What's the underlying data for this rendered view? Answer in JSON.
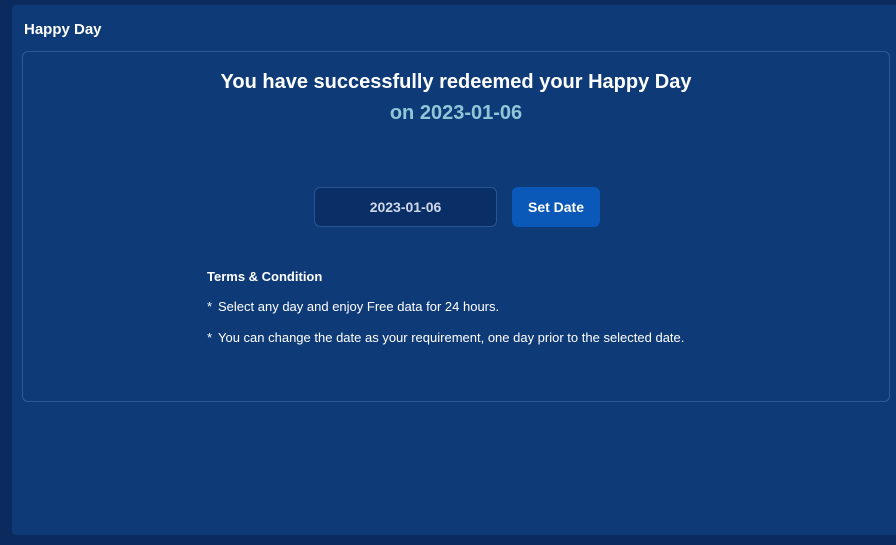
{
  "panel": {
    "title": "Happy Day"
  },
  "message": {
    "headline": "You have successfully redeemed your Happy Day",
    "subline": "on 2023-01-06"
  },
  "date_form": {
    "value": "2023-01-06",
    "button_label": "Set Date"
  },
  "terms": {
    "title": "Terms & Condition",
    "bullet": "*",
    "items": [
      "Select any day and enjoy Free data for 24 hours.",
      "You can change the date as your requirement, one day prior to the selected date."
    ]
  },
  "colors": {
    "page_bg": "#0b2a5e",
    "panel_bg": "#0e3a78",
    "accent_text": "#8fc7d8",
    "button_bg": "#0a58b8"
  }
}
